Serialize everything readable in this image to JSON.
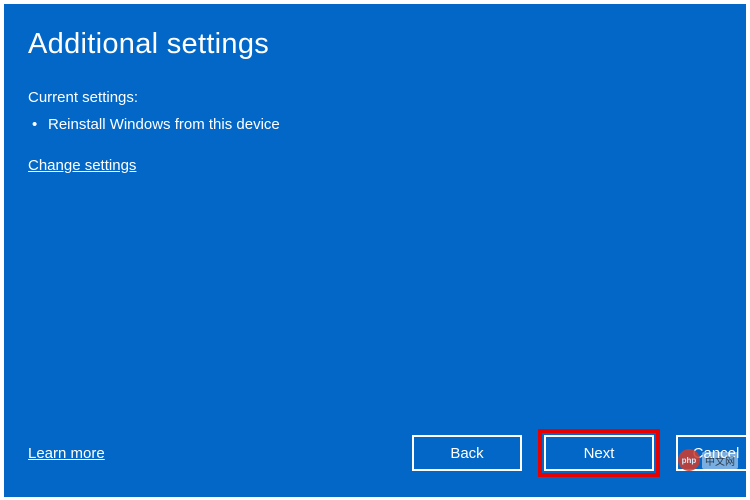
{
  "page": {
    "title": "Additional settings"
  },
  "current_settings": {
    "label": "Current settings:",
    "items": [
      "Reinstall Windows from this device"
    ]
  },
  "links": {
    "change_settings": "Change settings",
    "learn_more": "Learn more"
  },
  "buttons": {
    "back": "Back",
    "next": "Next",
    "cancel": "Cancel"
  },
  "watermark": {
    "logo_text": "php",
    "text": "中文网"
  }
}
